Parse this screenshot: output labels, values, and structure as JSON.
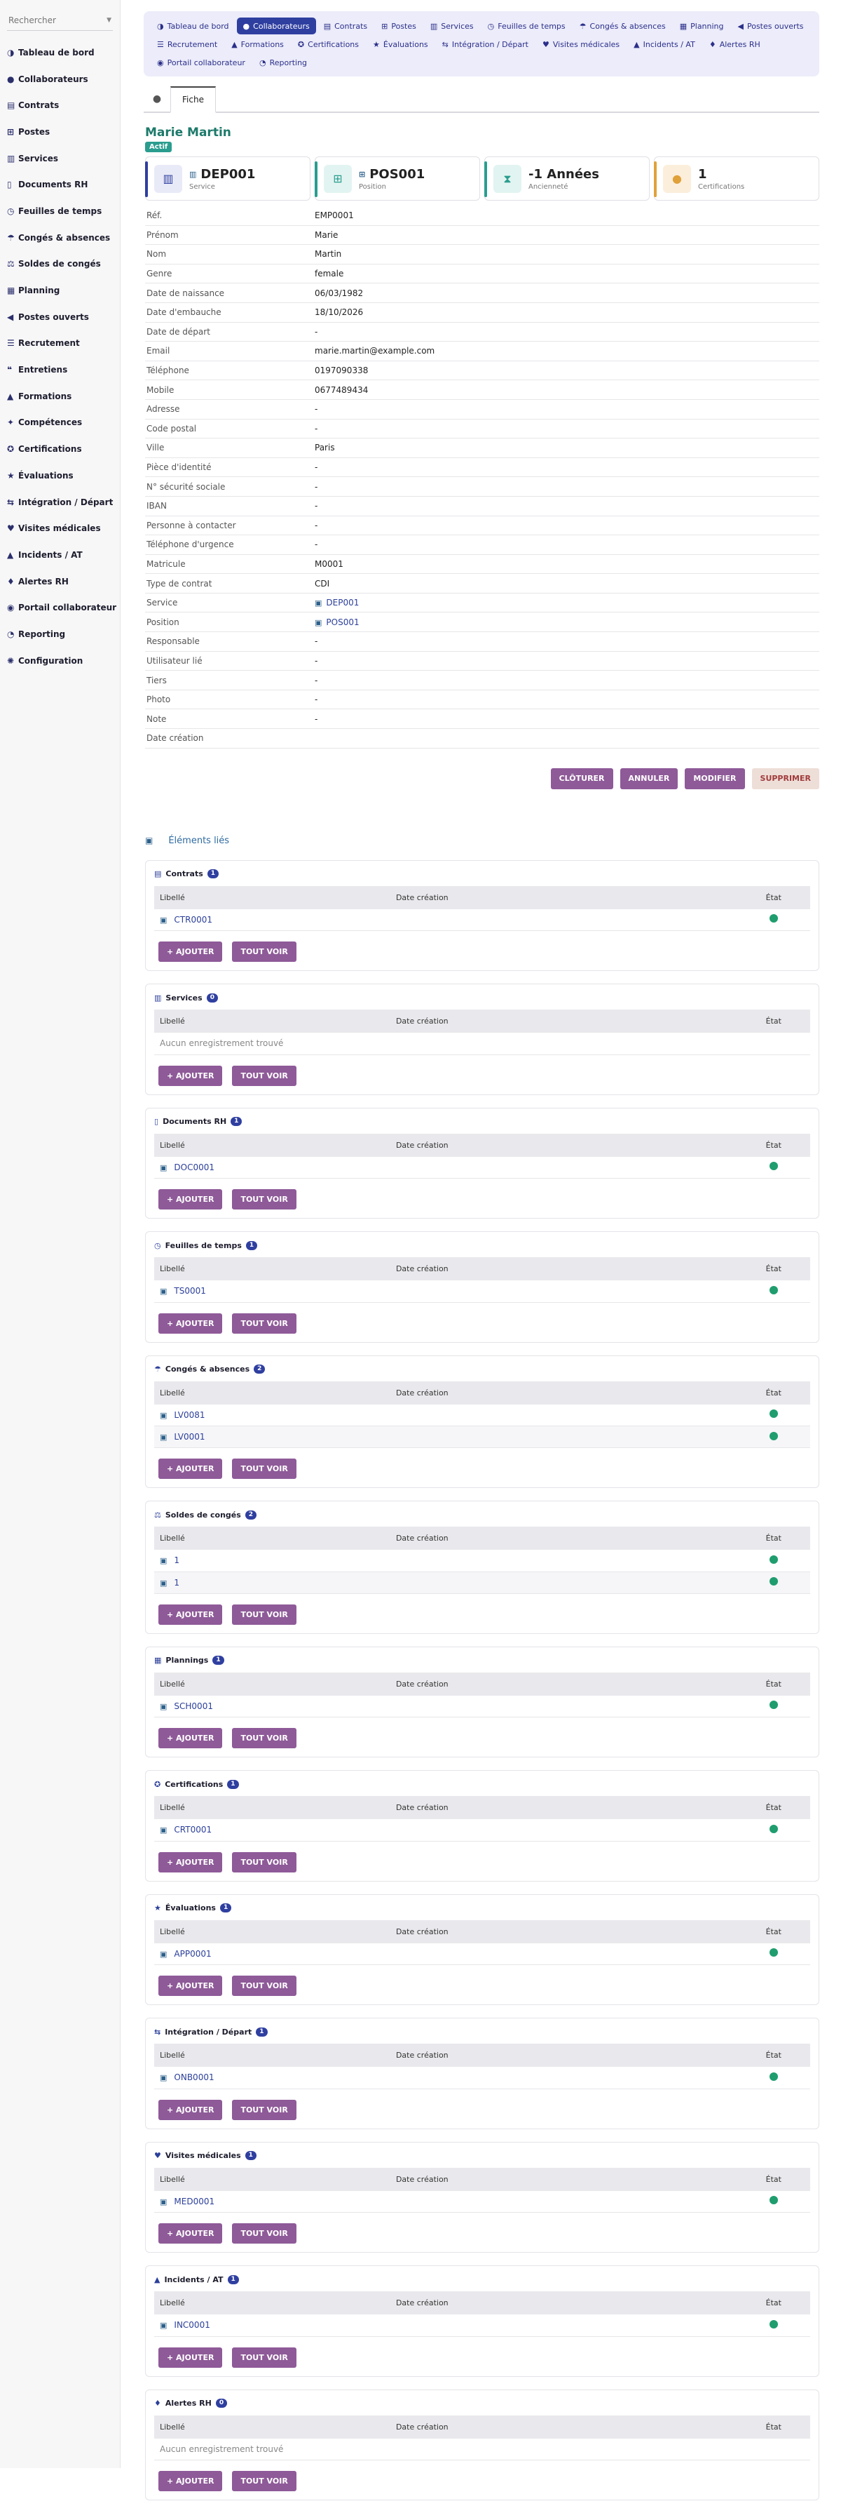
{
  "search": {
    "placeholder": "Rechercher"
  },
  "sidebar": {
    "items": [
      {
        "label": "Tableau de bord",
        "icon": "gauge-icon",
        "glyph": "◑"
      },
      {
        "label": "Collaborateurs",
        "icon": "user-icon",
        "glyph": "●"
      },
      {
        "label": "Contrats",
        "icon": "file-icon",
        "glyph": "▤"
      },
      {
        "label": "Postes",
        "icon": "sitemap-icon",
        "glyph": "⊞"
      },
      {
        "label": "Services",
        "icon": "building-icon",
        "glyph": "▥"
      },
      {
        "label": "Documents RH",
        "icon": "document-icon",
        "glyph": "▯"
      },
      {
        "label": "Feuilles de temps",
        "icon": "clock-icon",
        "glyph": "◷"
      },
      {
        "label": "Congés & absences",
        "icon": "umbrella-beach-icon",
        "glyph": "☂"
      },
      {
        "label": "Soldes de congés",
        "icon": "balance-icon",
        "glyph": "⚖"
      },
      {
        "label": "Planning",
        "icon": "calendar-icon",
        "glyph": "▦"
      },
      {
        "label": "Postes ouverts",
        "icon": "megaphone-icon",
        "glyph": "◀"
      },
      {
        "label": "Recrutement",
        "icon": "list-icon",
        "glyph": "☰"
      },
      {
        "label": "Entretiens",
        "icon": "comments-icon",
        "glyph": "❝"
      },
      {
        "label": "Formations",
        "icon": "graduation-icon",
        "glyph": "▲"
      },
      {
        "label": "Compétences",
        "icon": "lightbulb-icon",
        "glyph": "✦"
      },
      {
        "label": "Certifications",
        "icon": "certificate-icon",
        "glyph": "✪"
      },
      {
        "label": "Évaluations",
        "icon": "star-icon",
        "glyph": "★"
      },
      {
        "label": "Intégration / Départ",
        "icon": "door-icon",
        "glyph": "⇆"
      },
      {
        "label": "Visites médicales",
        "icon": "stethoscope-icon",
        "glyph": "♥"
      },
      {
        "label": "Incidents / AT",
        "icon": "warning-icon",
        "glyph": "▲"
      },
      {
        "label": "Alertes RH",
        "icon": "bell-icon",
        "glyph": "♦"
      },
      {
        "label": "Portail collaborateur",
        "icon": "user-circle-icon",
        "glyph": "◉"
      },
      {
        "label": "Reporting",
        "icon": "chart-icon",
        "glyph": "◔"
      },
      {
        "label": "Configuration",
        "icon": "gear-icon",
        "glyph": "✺"
      }
    ]
  },
  "topnav": {
    "items": [
      {
        "label": "Tableau de bord",
        "icon": "gauge-icon",
        "glyph": "◑",
        "active": false
      },
      {
        "label": "Collaborateurs",
        "icon": "user-icon",
        "glyph": "●",
        "active": true
      },
      {
        "label": "Contrats",
        "icon": "file-icon",
        "glyph": "▤",
        "active": false
      },
      {
        "label": "Postes",
        "icon": "sitemap-icon",
        "glyph": "⊞",
        "active": false
      },
      {
        "label": "Services",
        "icon": "building-icon",
        "glyph": "▥",
        "active": false
      },
      {
        "label": "Feuilles de temps",
        "icon": "clock-icon",
        "glyph": "◷",
        "active": false
      },
      {
        "label": "Congés & absences",
        "icon": "umbrella-beach-icon",
        "glyph": "☂",
        "active": false
      },
      {
        "label": "Planning",
        "icon": "calendar-icon",
        "glyph": "▦",
        "active": false
      },
      {
        "label": "Postes ouverts",
        "icon": "megaphone-icon",
        "glyph": "◀",
        "active": false
      },
      {
        "label": "Recrutement",
        "icon": "list-icon",
        "glyph": "☰",
        "active": false
      },
      {
        "label": "Formations",
        "icon": "graduation-icon",
        "glyph": "▲",
        "active": false
      },
      {
        "label": "Certifications",
        "icon": "certificate-icon",
        "glyph": "✪",
        "active": false
      },
      {
        "label": "Évaluations",
        "icon": "star-icon",
        "glyph": "★",
        "active": false
      },
      {
        "label": "Intégration / Départ",
        "icon": "door-icon",
        "glyph": "⇆",
        "active": false
      },
      {
        "label": "Visites médicales",
        "icon": "stethoscope-icon",
        "glyph": "♥",
        "active": false
      },
      {
        "label": "Incidents / AT",
        "icon": "warning-icon",
        "glyph": "▲",
        "active": false
      },
      {
        "label": "Alertes RH",
        "icon": "bell-icon",
        "glyph": "♦",
        "active": false
      },
      {
        "label": "Portail collaborateur",
        "icon": "user-circle-icon",
        "glyph": "◉",
        "active": false
      },
      {
        "label": "Reporting",
        "icon": "chart-icon",
        "glyph": "◔",
        "active": false
      }
    ]
  },
  "tabs": {
    "icon": "user-icon",
    "fiche": "Fiche"
  },
  "record": {
    "title": "Marie Martin",
    "status": "Actif",
    "status_color": "#2a9d8f"
  },
  "cards": [
    {
      "value": "DEP001",
      "label": "Service",
      "icon": "building-icon",
      "glyph": "▥",
      "accent": "#2f3fa0",
      "bg": "#e8eaf7",
      "fg": "#2f3fa0",
      "linked": true
    },
    {
      "value": "POS001",
      "label": "Position",
      "icon": "sitemap-icon",
      "glyph": "⊞",
      "accent": "#2a9d8f",
      "bg": "#e2f4f1",
      "fg": "#2a9d8f",
      "linked": true
    },
    {
      "value": "-1 Années",
      "label": "Ancienneté",
      "icon": "hourglass-icon",
      "glyph": "⧗",
      "accent": "#2a9d8f",
      "bg": "#e2f4f1",
      "fg": "#2a9d8f",
      "linked": false
    },
    {
      "value": "1",
      "label": "Certifications",
      "icon": "certificate-icon",
      "glyph": "●",
      "accent": "#e0a13a",
      "bg": "#fbefdc",
      "fg": "#e0a13a",
      "linked": false
    }
  ],
  "fields": [
    {
      "label": "Réf.",
      "value": "EMP0001",
      "link": false
    },
    {
      "label": "Prénom",
      "value": "Marie",
      "link": false
    },
    {
      "label": "Nom",
      "value": "Martin",
      "link": false
    },
    {
      "label": "Genre",
      "value": "female",
      "link": false
    },
    {
      "label": "Date de naissance",
      "value": "06/03/1982",
      "link": false
    },
    {
      "label": "Date d'embauche",
      "value": "18/10/2026",
      "link": false
    },
    {
      "label": "Date de départ",
      "value": "-",
      "link": false
    },
    {
      "label": "Email",
      "value": "marie.martin@example.com",
      "link": false
    },
    {
      "label": "Téléphone",
      "value": "0197090338",
      "link": false
    },
    {
      "label": "Mobile",
      "value": "0677489434",
      "link": false
    },
    {
      "label": "Adresse",
      "value": "-",
      "link": false
    },
    {
      "label": "Code postal",
      "value": "-",
      "link": false
    },
    {
      "label": "Ville",
      "value": "Paris",
      "link": false
    },
    {
      "label": "Pièce d'identité",
      "value": "-",
      "link": false
    },
    {
      "label": "N° sécurité sociale",
      "value": "-",
      "link": false
    },
    {
      "label": "IBAN",
      "value": "-",
      "link": false
    },
    {
      "label": "Personne à contacter",
      "value": "-",
      "link": false
    },
    {
      "label": "Téléphone d'urgence",
      "value": "-",
      "link": false
    },
    {
      "label": "Matricule",
      "value": "M0001",
      "link": false
    },
    {
      "label": "Type de contrat",
      "value": "CDI",
      "link": false
    },
    {
      "label": "Service",
      "value": "DEP001",
      "link": true
    },
    {
      "label": "Position",
      "value": "POS001",
      "link": true
    },
    {
      "label": "Responsable",
      "value": "-",
      "link": false
    },
    {
      "label": "Utilisateur lié",
      "value": "-",
      "link": false
    },
    {
      "label": "Tiers",
      "value": "-",
      "link": false
    },
    {
      "label": "Photo",
      "value": "-",
      "link": false
    },
    {
      "label": "Note",
      "value": "-",
      "link": false
    },
    {
      "label": "Date création",
      "value": "",
      "link": false
    }
  ],
  "actions": {
    "cloturer": "CLÔTURER",
    "annuler": "ANNULER",
    "modifier": "MODIFIER",
    "supprimer": "SUPPRIMER"
  },
  "linked": {
    "title": "Éléments liés",
    "col_libelle": "Libellé",
    "col_date": "Date création",
    "col_etat": "État",
    "empty_text": "Aucun enregistrement trouvé",
    "add_label": "+ AJOUTER",
    "view_label": "TOUT VOIR",
    "sections": [
      {
        "title": "Contrats",
        "count": "1",
        "icon": "file-icon",
        "glyph": "▤",
        "date_pos": "c",
        "rows": [
          "CTR0001"
        ]
      },
      {
        "title": "Services",
        "count": "0",
        "icon": "building-icon",
        "glyph": "▥",
        "date_pos": "c",
        "rows": []
      },
      {
        "title": "Documents RH",
        "count": "1",
        "icon": "document-icon",
        "glyph": "▯",
        "date_pos": "c",
        "rows": [
          "DOC0001"
        ]
      },
      {
        "title": "Feuilles de temps",
        "count": "1",
        "icon": "clock-icon",
        "glyph": "◷",
        "date_pos": "c",
        "rows": [
          "TS0001"
        ]
      },
      {
        "title": "Congés & absences",
        "count": "2",
        "icon": "umbrella-beach-icon",
        "glyph": "☂",
        "date_pos": "c",
        "rows": [
          "LV0081",
          "LV0001"
        ]
      },
      {
        "title": "Soldes de congés",
        "count": "2",
        "icon": "balance-icon",
        "glyph": "⚖",
        "date_pos": "c",
        "rows": [
          "1",
          "1"
        ]
      },
      {
        "title": "Plannings",
        "count": "1",
        "icon": "calendar-icon",
        "glyph": "▦",
        "date_pos": "c",
        "rows": [
          "SCH0001"
        ]
      },
      {
        "title": "Certifications",
        "count": "1",
        "icon": "certificate-icon",
        "glyph": "✪",
        "date_pos": "c",
        "rows": [
          "CRT0001"
        ]
      },
      {
        "title": "Évaluations",
        "count": "1",
        "icon": "star-icon",
        "glyph": "★",
        "date_pos": "c",
        "rows": [
          "APP0001"
        ]
      },
      {
        "title": "Intégration / Départ",
        "count": "1",
        "icon": "door-icon",
        "glyph": "⇆",
        "date_pos": "c",
        "rows": [
          "ONB0001"
        ]
      },
      {
        "title": "Visites médicales",
        "count": "1",
        "icon": "stethoscope-icon",
        "glyph": "♥",
        "date_pos": "c",
        "rows": [
          "MED0001"
        ]
      },
      {
        "title": "Incidents / AT",
        "count": "1",
        "icon": "warning-icon",
        "glyph": "▲",
        "date_pos": "c",
        "rows": [
          "INC0001"
        ]
      },
      {
        "title": "Alertes RH",
        "count": "0",
        "icon": "bell-icon",
        "glyph": "♦",
        "date_pos": "c",
        "rows": []
      }
    ]
  },
  "colors": {
    "accent": "#2f3fa0",
    "button": "#8e5a98",
    "status_ok": "#1f9d6e",
    "title": "#1d7a6b"
  }
}
